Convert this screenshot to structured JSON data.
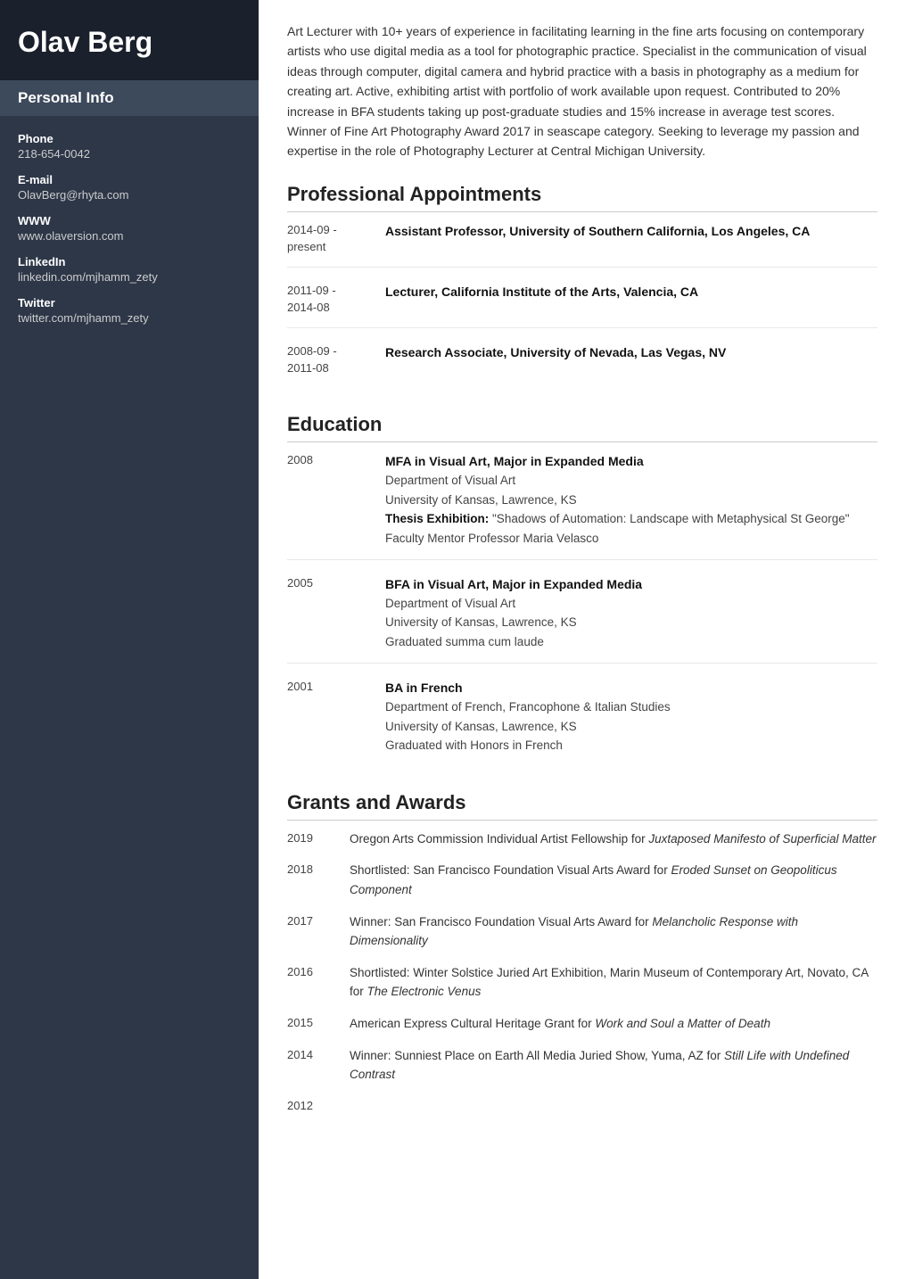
{
  "sidebar": {
    "name": "Olav Berg",
    "personal_info_label": "Personal Info",
    "fields": [
      {
        "label": "Phone",
        "value": "218-654-0042"
      },
      {
        "label": "E-mail",
        "value": "OlavBerg@rhyta.com"
      },
      {
        "label": "WWW",
        "value": "www.olaversion.com"
      },
      {
        "label": "LinkedIn",
        "value": "linkedin.com/mjhamm_zety"
      },
      {
        "label": "Twitter",
        "value": "twitter.com/mjhamm_zety"
      }
    ]
  },
  "main": {
    "summary": "Art Lecturer with 10+ years of experience in facilitating learning in the fine arts focusing on contemporary artists who use digital media as a tool for photographic practice. Specialist in the communication of visual ideas through computer, digital camera and hybrid practice with a basis in photography as a medium for creating art. Active, exhibiting artist with portfolio of work available upon request. Contributed to 20% increase in BFA students taking up post-graduate studies and 15% increase in average test scores. Winner of Fine Art Photography Award 2017 in seascape category. Seeking to leverage my passion and expertise in the role of Photography Lecturer at Central Michigan University.",
    "sections": {
      "appointments_title": "Professional Appointments",
      "appointments": [
        {
          "date": "2014-09 - present",
          "title": "Assistant Professor, University of Southern California, Los Angeles, CA"
        },
        {
          "date": "2011-09 - 2014-08",
          "title": "Lecturer, California Institute of the Arts, Valencia, CA"
        },
        {
          "date": "2008-09 - 2011-08",
          "title": "Research Associate, University of Nevada, Las Vegas, NV"
        }
      ],
      "education_title": "Education",
      "education": [
        {
          "year": "2008",
          "degree": "MFA in Visual Art, Major in Expanded Media",
          "lines": [
            "Department of Visual Art",
            "University of Kansas, Lawrence, KS",
            "Thesis Exhibition: “Shadows of Automation: Landscape with Metaphysical St George”",
            "Faculty Mentor Professor Maria Velasco"
          ]
        },
        {
          "year": "2005",
          "degree": "BFA in Visual Art, Major in Expanded Media",
          "lines": [
            "Department of Visual Art",
            "University of Kansas, Lawrence, KS",
            "Graduated summa cum laude"
          ]
        },
        {
          "year": "2001",
          "degree": "BA in French",
          "lines": [
            "Department of French, Francophone & Italian Studies",
            "University of Kansas, Lawrence, KS",
            "Graduated with Honors in French"
          ]
        }
      ],
      "awards_title": "Grants and Awards",
      "awards": [
        {
          "year": "2019",
          "text": "Oregon Arts Commission Individual Artist Fellowship for ",
          "italic": "Juxtaposed Manifesto of Superficial Matter",
          "after": ""
        },
        {
          "year": "2018",
          "text": "Shortlisted: San Francisco Foundation Visual Arts Award for ",
          "italic": "Eroded Sunset on Geopoliticus Component",
          "after": ""
        },
        {
          "year": "2017",
          "text": "Winner: San Francisco Foundation Visual Arts Award for ",
          "italic": "Melancholic Response with Dimensionality",
          "after": ""
        },
        {
          "year": "2016",
          "text": "Shortlisted: Winter Solstice Juried Art Exhibition, Marin Museum of Contemporary Art, Novato, CA for ",
          "italic": "The Electronic Venus",
          "after": ""
        },
        {
          "year": "2015",
          "text": "American Express Cultural Heritage Grant for ",
          "italic": "Work and Soul a Matter of Death",
          "after": ""
        },
        {
          "year": "2014",
          "text": "Winner: Sunniest Place on Earth All Media Juried Show, Yuma, AZ for ",
          "italic": "Still Life with Undefined Contrast",
          "after": ""
        },
        {
          "year": "2012",
          "text": "",
          "italic": "",
          "after": ""
        }
      ]
    }
  }
}
